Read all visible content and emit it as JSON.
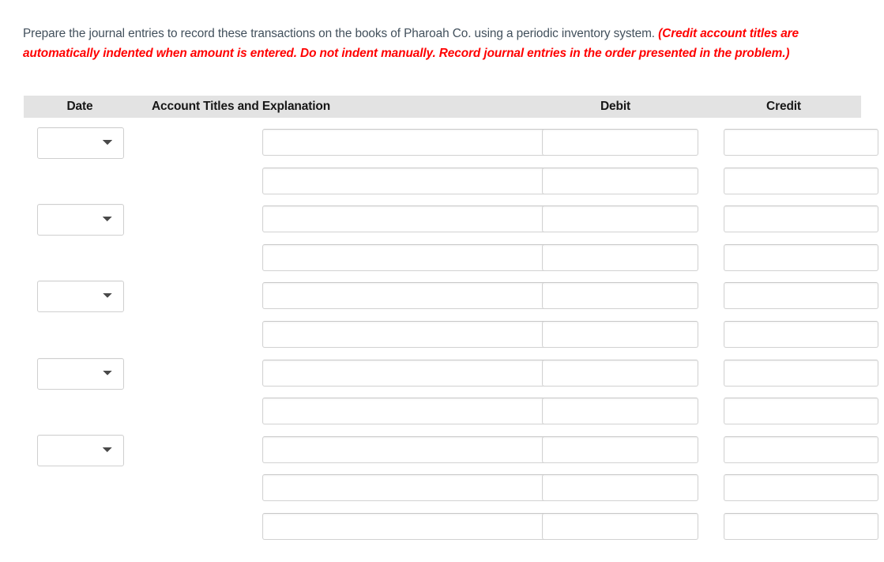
{
  "instructions": {
    "plain_text": "Prepare the journal entries to record these transactions on the books of Pharoah Co. using a periodic inventory system. ",
    "emphasis_text": "(Credit account titles are automatically indented when amount is entered. Do not indent manually. Record journal entries in the order presented in the problem.)",
    "emphasis_color": "#ff0000",
    "body_color": "#42505c"
  },
  "table": {
    "header_background": "#e3e3e3",
    "columns": [
      {
        "key": "date",
        "label": "Date"
      },
      {
        "key": "account",
        "label": "Account Titles and Explanation"
      },
      {
        "key": "debit",
        "label": "Debit"
      },
      {
        "key": "credit",
        "label": "Credit"
      }
    ],
    "date_select": {
      "selected_value": "",
      "options": [
        ""
      ],
      "icon": "chevron-down-icon"
    },
    "input_value": "",
    "input_placeholder": "",
    "rows": [
      {
        "index": 1,
        "has_date_select": true,
        "date": "",
        "account": "",
        "debit": "",
        "credit": ""
      },
      {
        "index": 2,
        "has_date_select": false,
        "date": "",
        "account": "",
        "debit": "",
        "credit": ""
      },
      {
        "index": 3,
        "has_date_select": true,
        "date": "",
        "account": "",
        "debit": "",
        "credit": ""
      },
      {
        "index": 4,
        "has_date_select": false,
        "date": "",
        "account": "",
        "debit": "",
        "credit": ""
      },
      {
        "index": 5,
        "has_date_select": true,
        "date": "",
        "account": "",
        "debit": "",
        "credit": ""
      },
      {
        "index": 6,
        "has_date_select": false,
        "date": "",
        "account": "",
        "debit": "",
        "credit": ""
      },
      {
        "index": 7,
        "has_date_select": true,
        "date": "",
        "account": "",
        "debit": "",
        "credit": ""
      },
      {
        "index": 8,
        "has_date_select": false,
        "date": "",
        "account": "",
        "debit": "",
        "credit": ""
      },
      {
        "index": 9,
        "has_date_select": true,
        "date": "",
        "account": "",
        "debit": "",
        "credit": ""
      },
      {
        "index": 10,
        "has_date_select": false,
        "date": "",
        "account": "",
        "debit": "",
        "credit": ""
      },
      {
        "index": 11,
        "has_date_select": false,
        "date": "",
        "account": "",
        "debit": "",
        "credit": ""
      }
    ]
  }
}
